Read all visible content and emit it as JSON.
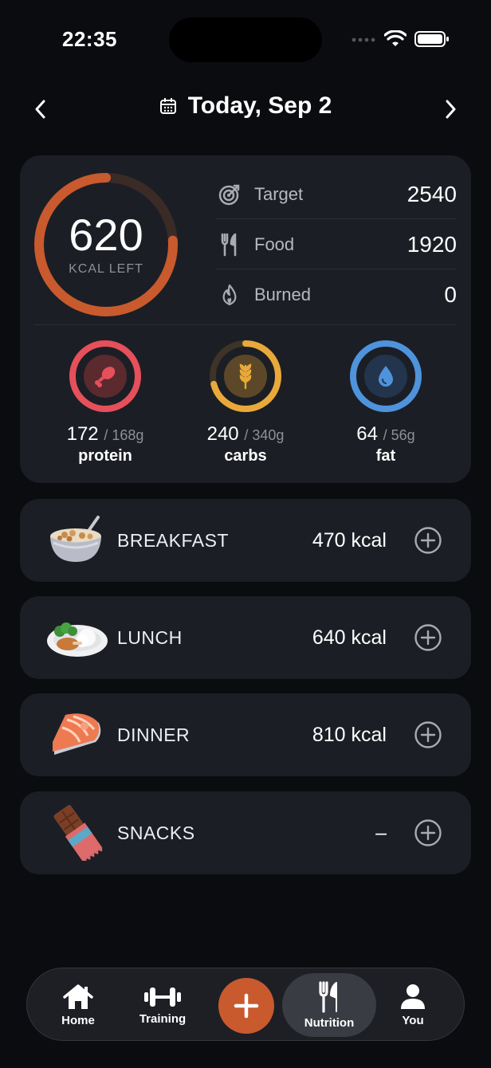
{
  "status": {
    "time": "22:35"
  },
  "header": {
    "date_title": "Today, Sep 2"
  },
  "summary": {
    "kcal_left": "620",
    "kcal_left_label": "KCAL LEFT",
    "kcal_consumed_fraction": 0.76,
    "stats": [
      {
        "icon": "target-icon",
        "label": "Target",
        "value": "2540"
      },
      {
        "icon": "fork-knife-icon",
        "label": "Food",
        "value": "1920"
      },
      {
        "icon": "flame-icon",
        "label": "Burned",
        "value": "0"
      }
    ],
    "macros": [
      {
        "name": "protein",
        "amount": "172",
        "goal": "/ 168g",
        "fraction": 1.0,
        "color": "#e5505a",
        "icon": "drumstick-icon"
      },
      {
        "name": "carbs",
        "amount": "240",
        "goal": "/ 340g",
        "fraction": 0.71,
        "color": "#e9a93a",
        "icon": "wheat-icon"
      },
      {
        "name": "fat",
        "amount": "64",
        "goal": "/ 56g",
        "fraction": 1.0,
        "color": "#4e93dc",
        "icon": "droplet-icon"
      }
    ]
  },
  "meals": [
    {
      "name": "BREAKFAST",
      "kcal": "470 kcal",
      "icon": "cereal-bowl-icon"
    },
    {
      "name": "LUNCH",
      "kcal": "640 kcal",
      "icon": "chicken-plate-icon"
    },
    {
      "name": "DINNER",
      "kcal": "810 kcal",
      "icon": "salmon-icon"
    },
    {
      "name": "SNACKS",
      "kcal": "–",
      "icon": "chocolate-bar-icon"
    }
  ],
  "tabbar": {
    "tabs": [
      {
        "label": "Home",
        "icon": "home-icon"
      },
      {
        "label": "Training",
        "icon": "dumbbell-icon"
      },
      {
        "label": "Nutrition",
        "icon": "fork-knife-icon",
        "active": true
      },
      {
        "label": "You",
        "icon": "person-icon"
      }
    ],
    "add_icon": "plus-icon"
  },
  "colors": {
    "accent": "#c85a2e",
    "card": "#1c1e25",
    "background": "#0b0c10"
  }
}
